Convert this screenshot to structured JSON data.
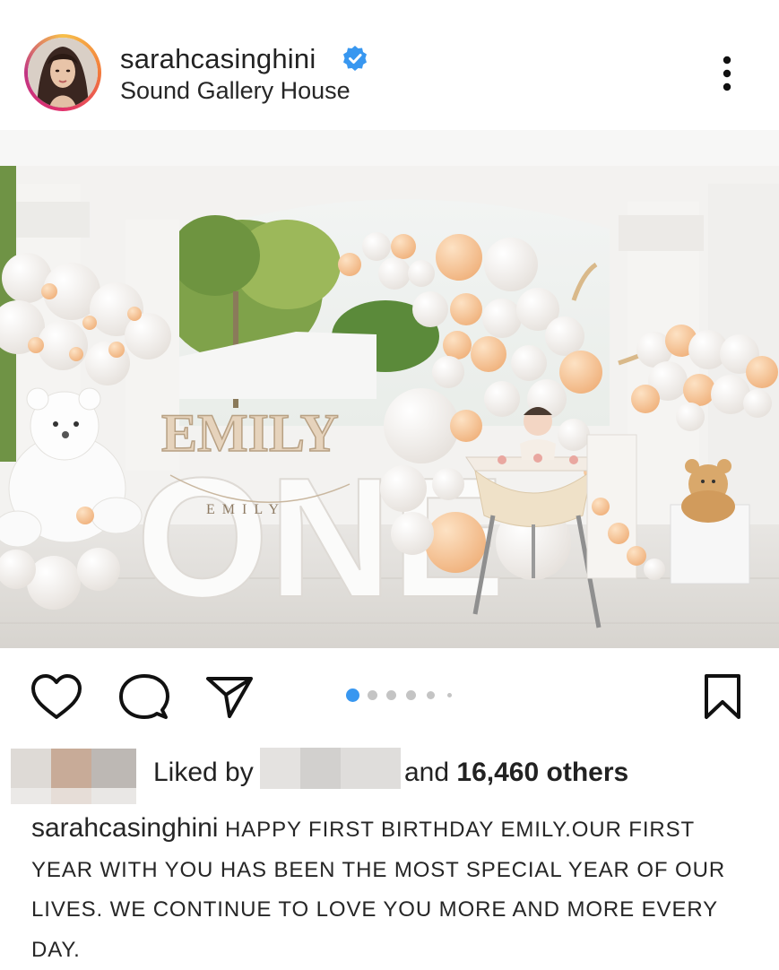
{
  "post": {
    "username": "sarahcasinghini",
    "location": "Sound Gallery House",
    "liked_by_prefix": "Liked by",
    "likes_and": "and",
    "likes_count": "16,460 others",
    "caption_text": "HAPPY FIRST BIRTHDAY EMILY.OUR FIRST YEAR WITH YOU HAS BEEN THE MOST SPECIAL YEAR OF OUR LIVES. WE CONTINUE TO LOVE YOU MORE AND MORE EVERY DAY.",
    "carousel": {
      "total": 6,
      "current": 1
    }
  },
  "photo": {
    "letters_top": "EMILY",
    "letters_big": "ONE",
    "banner": "EMILY"
  },
  "colors": {
    "verified": "#3897f0",
    "active_dot": "#3897f0",
    "inactive_dot": "#c4c4c4",
    "balloon_peach": "#f6c79b",
    "balloon_white": "#f7f4f0"
  },
  "icons": {
    "like": "heart-icon",
    "comment": "comment-icon",
    "share": "paper-plane-icon",
    "save": "bookmark-icon",
    "more": "more-vertical-icon",
    "verified": "verified-badge-icon"
  }
}
